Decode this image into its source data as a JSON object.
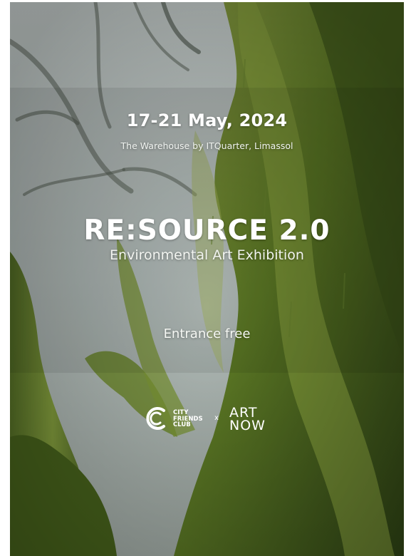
{
  "event": {
    "date": "17-21 May, 2024",
    "venue": "The Warehouse by ITQuarter, Limassol",
    "title": "RE:SOURCE 2.0",
    "subtitle": "Environmental Art Exhibition",
    "entrance": "Entrance free"
  },
  "logos": {
    "city_friends_club": [
      "CITY",
      "FRIENDS",
      "CLUB"
    ],
    "separator": "x",
    "art_now": [
      "ART",
      "NOW"
    ],
    "city_friends_club_icon": "c-swirl-logo-icon"
  },
  "colors": {
    "moss": "#6f8a2e",
    "fog": "#b9c3c2",
    "text": "#ffffff"
  }
}
